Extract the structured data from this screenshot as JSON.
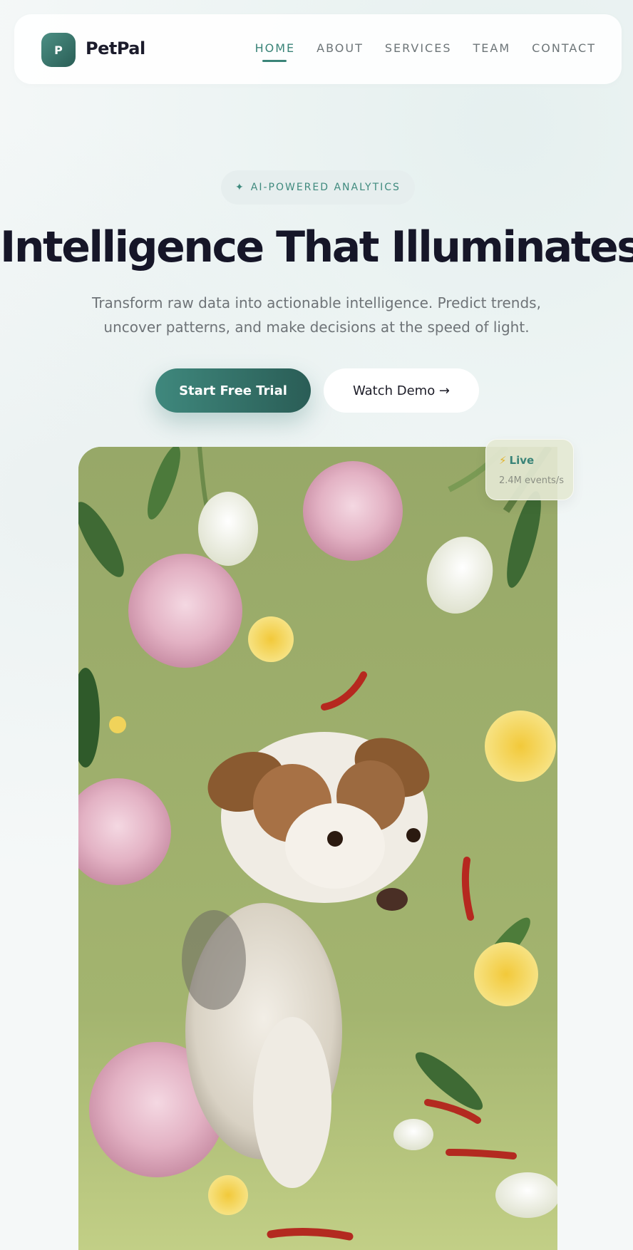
{
  "brand": {
    "logo_letter": "P",
    "name": "PetPal"
  },
  "nav": {
    "items": [
      {
        "label": "HOME",
        "active": true
      },
      {
        "label": "ABOUT",
        "active": false
      },
      {
        "label": "SERVICES",
        "active": false
      },
      {
        "label": "TEAM",
        "active": false
      },
      {
        "label": "CONTACT",
        "active": false
      }
    ]
  },
  "hero": {
    "badge_icon": "✦",
    "badge_label": "AI-POWERED ANALYTICS",
    "headline": "Intelligence That Illuminates",
    "subtext": "Transform raw data into actionable intelligence. Predict trends, uncover patterns, and make decisions at the speed of light.",
    "primary_cta": "Start Free Trial",
    "secondary_cta": "Watch Demo →"
  },
  "live_card": {
    "icon": "lightning-icon",
    "title": "Live",
    "subtitle": "2.4M events/s"
  },
  "colors": {
    "accent": "#3a8478",
    "heading": "#161628",
    "muted": "#6e7377"
  }
}
